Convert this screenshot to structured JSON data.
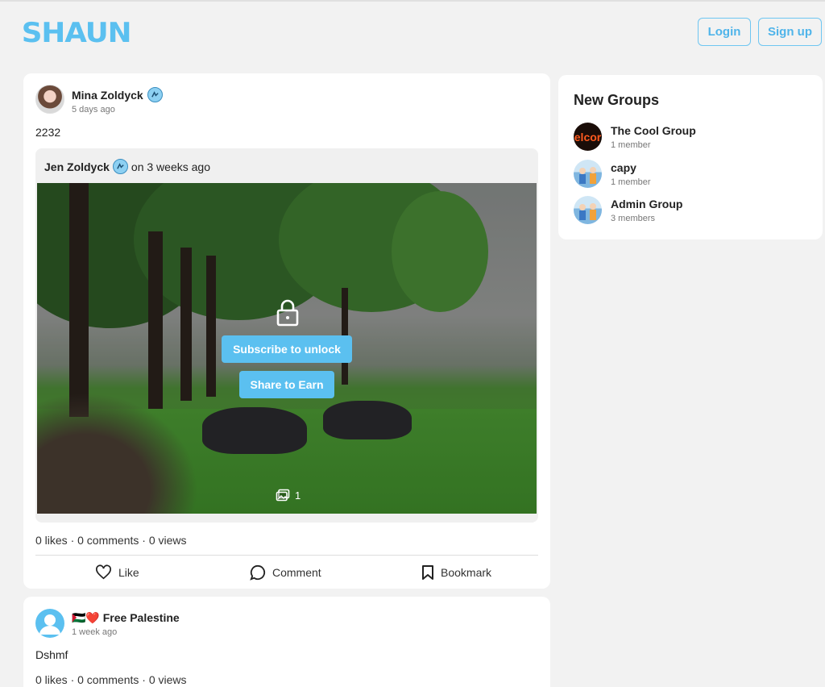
{
  "header": {
    "logo": "SHAUN",
    "login_label": "Login",
    "signup_label": "Sign up"
  },
  "posts": [
    {
      "author": "Mina Zoldyck",
      "time": "5 days ago",
      "text": "2232",
      "shared": {
        "author": "Jen Zoldyck",
        "time": "on 3 weeks ago",
        "subscribe_label": "Subscribe to unlock",
        "share_label": "Share to Earn",
        "image_count": "1"
      },
      "stats": "0 likes · 0 comments · 0 views",
      "actions": {
        "like": "Like",
        "comment": "Comment",
        "bookmark": "Bookmark"
      }
    },
    {
      "author": "🇵🇸❤️ Free Palestine",
      "time": "1 week ago",
      "text": "Dshmf",
      "stats": "0 likes · 0 comments · 0 views"
    }
  ],
  "groups": {
    "title": "New Groups",
    "items": [
      {
        "name": "The Cool Group",
        "meta": "1 member",
        "avatar_text": "elcor"
      },
      {
        "name": "capy",
        "meta": "1 member"
      },
      {
        "name": "Admin Group",
        "meta": "3 members"
      }
    ]
  },
  "colors": {
    "accent": "#5bc0f0",
    "background": "#f2f2f2",
    "card": "#ffffff"
  }
}
